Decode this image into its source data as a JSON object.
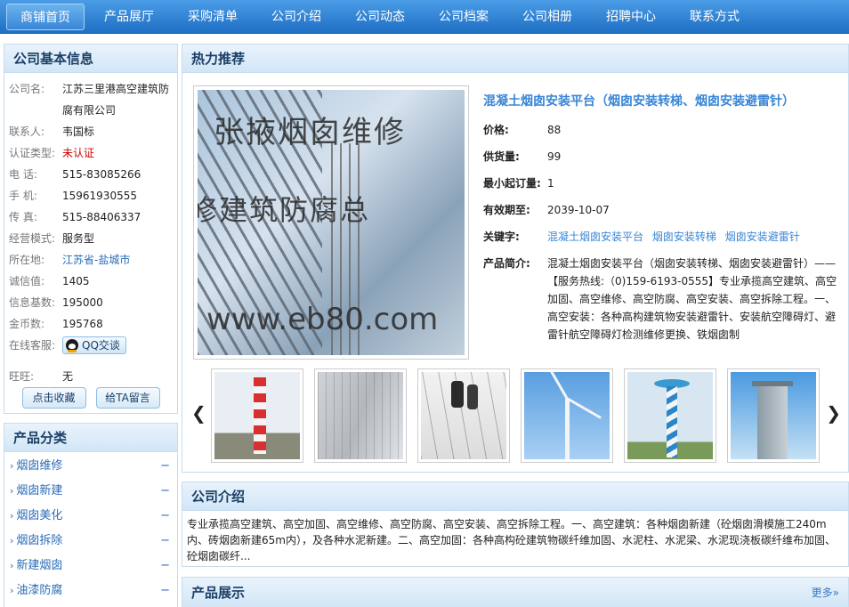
{
  "nav": {
    "items": [
      "商铺首页",
      "产品展厅",
      "采购清单",
      "公司介绍",
      "公司动态",
      "公司档案",
      "公司相册",
      "招聘中心",
      "联系方式"
    ]
  },
  "info": {
    "heading": "公司基本信息",
    "company_label": "公司名:",
    "company": "江苏三里港高空建筑防腐有限公司",
    "contact_label": "联系人:",
    "contact": "韦国标",
    "cert_label": "认证类型:",
    "cert": "未认证",
    "phone_label": "电  话:",
    "phone": "515-83085266",
    "mobile_label": "手  机:",
    "mobile": "15961930555",
    "fax_label": "传  真:",
    "fax": "515-88406337",
    "mode_label": "经营模式:",
    "mode": "服务型",
    "location_label": "所在地:",
    "location": "江苏省-盐城市",
    "credit_label": "诚信值:",
    "credit": "1405",
    "base_label": "信息基数:",
    "base": "195000",
    "coins_label": "金币数:",
    "coins": "195768",
    "online_label": "在线客服:",
    "qq_label": "QQ交谈",
    "wangwang_label": "旺旺:",
    "wangwang": "无",
    "fav_button": "点击收藏",
    "msg_button": "给TA留言"
  },
  "categories": {
    "heading": "产品分类",
    "items": [
      "烟囱维修",
      "烟囱新建",
      "烟囱美化",
      "烟囱拆除",
      "新建烟囱",
      "油漆防腐"
    ]
  },
  "hot": {
    "heading": "热力推荐",
    "image_text": [
      "张掖烟囱维修",
      "修建筑防腐总",
      "www.eb80.com"
    ],
    "title": "混凝土烟囱安装平台（烟囱安装转梯、烟囱安装避雷针）",
    "price_label": "价格:",
    "price": "88",
    "stock_label": "供货量:",
    "stock": "99",
    "min_label": "最小起订量:",
    "min": "1",
    "valid_label": "有效期至:",
    "valid": "2039-10-07",
    "kw_label": "关键字:",
    "keywords": [
      "混凝土烟囱安装平台",
      "烟囱安装转梯",
      "烟囱安装避雷针"
    ],
    "desc_label": "产品简介:",
    "desc": "混凝土烟囱安装平台（烟囱安装转梯、烟囱安装避雷针）——【服务热线:（0)159-6193-0555】专业承揽高空建筑、高空加固、高空维修、高空防腐、高空安装、高空拆除工程。一、高空安装：各种高构建筑物安装避雷针、安装航空障碍灯、避雷针航空障碍灯检测维修更换、铁烟囱制",
    "prev": "❮",
    "next": "❯"
  },
  "intro": {
    "heading": "公司介绍",
    "text": "专业承揽高空建筑、高空加固、高空维修、高空防腐、高空安装、高空拆除工程。一、高空建筑：各种烟囱新建（砼烟囱滑模施工240m内、砖烟囱新建65m内），及各种水泥新建。二、高空加固：各种高构砼建筑物碳纤维加固、水泥柱、水泥梁、水泥现浇板碳纤维布加固、砼烟囱碳纤..."
  },
  "products": {
    "heading": "产品展示",
    "more": "更多»"
  }
}
